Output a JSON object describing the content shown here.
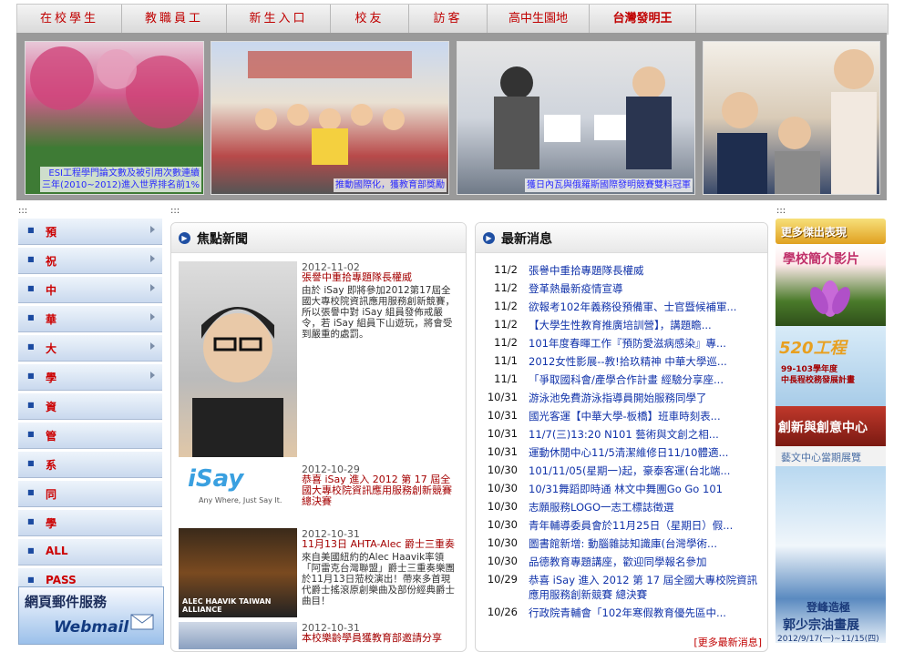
{
  "topnav": {
    "tabs": [
      "在校學生",
      "教職員工",
      "新生入口",
      "校友",
      "訪客",
      "高中生園地",
      "台灣發明王"
    ]
  },
  "banner": {
    "captions": [
      "ESI工程學門論文數及被引用次數連續\n三年(2010~2012)進入世界排名前1%",
      "推動國際化，獲教育部獎勵",
      "獲日內瓦與俄羅斯國際發明競賽雙料冠軍",
      ""
    ]
  },
  "section_dots": ":::",
  "leftnav": {
    "items": [
      {
        "label": "預",
        "has_arrow": true
      },
      {
        "label": "祝",
        "has_arrow": true
      },
      {
        "label": "中",
        "has_arrow": true
      },
      {
        "label": "華",
        "has_arrow": true
      },
      {
        "label": "大",
        "has_arrow": true
      },
      {
        "label": "學",
        "has_arrow": true
      },
      {
        "label": "資",
        "has_arrow": false
      },
      {
        "label": "管",
        "has_arrow": false
      },
      {
        "label": "系",
        "has_arrow": false
      },
      {
        "label": "同",
        "has_arrow": false
      },
      {
        "label": "學",
        "has_arrow": false
      },
      {
        "label": "ALL",
        "has_arrow": false
      },
      {
        "label": "PASS",
        "has_arrow": false
      }
    ],
    "webmail_title": "網頁郵件服務",
    "webmail_label": "Webmail"
  },
  "focus_news": {
    "title": "焦點新聞",
    "items": [
      {
        "date": "2012-11-02",
        "title": "張譽中重拾專題隊長權威",
        "body": "由於 iSay 即將參加2012第17屆全國大專校院資訊應用服務創新競賽，所以張譽中對 iSay 組員發佈戒嚴令，若 iSay 組員下山遊玩，將會受到嚴重的處罰。"
      },
      {
        "date": "2012-10-29",
        "title": "恭喜 iSay 進入 2012 第 17 屆全國大專校院資訊應用服務創新競賽 總決賽",
        "body": ""
      },
      {
        "date": "2012-10-31",
        "title": "11月13日 AHTA-Alec 爵士三重奏",
        "body": "來自美國紐約的Alec Haavik率領「阿雷克台灣聯盟」爵士三重奏樂團於11月13日蒞校演出！帶來多首現代爵士搖滾原創樂曲及部份經典爵士曲目！"
      },
      {
        "date": "2012-10-31",
        "title": "本校樂齡學員獲教育部邀請分享",
        "body": ""
      }
    ],
    "isay_logo": "iSay",
    "isay_slogan": "Any Where, Just Say It.",
    "jazz_caption": "ALEC HAAVIK TAIWAN ALLIANCE"
  },
  "latest_news": {
    "title": "最新消息",
    "items": [
      {
        "date": "11/2",
        "title": "張譽中重拾專題隊長權威"
      },
      {
        "date": "11/2",
        "title": "登革熱最新疫情宣導"
      },
      {
        "date": "11/2",
        "title": "欲報考102年義務役預備軍、士官暨候補軍..."
      },
      {
        "date": "11/2",
        "title": "【大學生性教育推廣培訓營】，講題瞻..."
      },
      {
        "date": "11/2",
        "title": "101年度春暉工作『預防愛滋病感染』專..."
      },
      {
        "date": "11/1",
        "title": "2012女性影展--教!拾玖精神 中華大學巡..."
      },
      {
        "date": "11/1",
        "title": "「爭取國科會/產學合作計畫 經驗分享座..."
      },
      {
        "date": "10/31",
        "title": "游泳池免費游泳指導員開始服務同學了"
      },
      {
        "date": "10/31",
        "title": "國光客運【中華大學-板橋】班車時刻表..."
      },
      {
        "date": "10/31",
        "title": "11/7(三)13:20 N101 藝術與文創之相..."
      },
      {
        "date": "10/31",
        "title": "運動休閒中心11/5清潔維修日11/10體適..."
      },
      {
        "date": "10/30",
        "title": "101/11/05(星期一)起，豪泰客運(台北端..."
      },
      {
        "date": "10/30",
        "title": "10/31舞蹈即時通 林文中舞團Go Go 101"
      },
      {
        "date": "10/30",
        "title": "志願服務LOGO一志工標誌徵選"
      },
      {
        "date": "10/30",
        "title": "青年輔導委員會於11月25日（星期日）假..."
      },
      {
        "date": "10/30",
        "title": "圖書館新增: 動腦雜誌知識庫(台灣學術..."
      },
      {
        "date": "10/30",
        "title": "品德教育專題講座，歡迎同學報名參加"
      },
      {
        "date": "10/29",
        "title": "恭喜 iSay 進入 2012 第 17 屆全國大專校院資訊應用服務創新競賽 總決賽"
      },
      {
        "date": "10/26",
        "title": "行政院青輔會「102年寒假教育優先區中..."
      }
    ],
    "more": "[更多最新消息]"
  },
  "right": {
    "more_label": "更多傑出表現",
    "video_label": "學校簡介影片",
    "project_title": "520工程",
    "project_sub": "99-103學年度\n中長程校務發展計畫",
    "innov_label": "創新與創意中心",
    "art_title": "藝文中心當期展覽",
    "art_poster_title": "登峰造極",
    "art_poster_name": "郭少宗油畫展",
    "art_poster_date": "2012/9/17(一)~11/15(四)"
  }
}
